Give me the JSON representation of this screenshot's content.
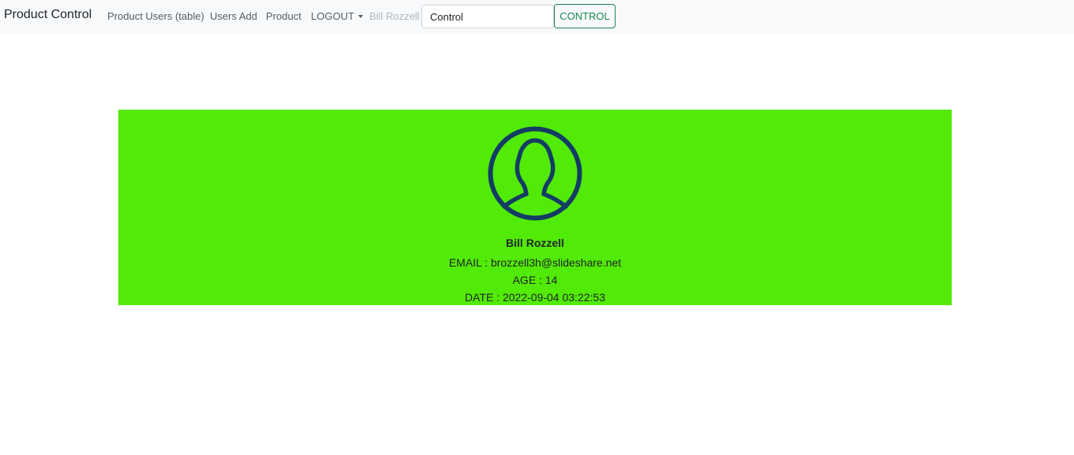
{
  "navbar": {
    "brand": "Product Control",
    "links": [
      {
        "label": "Product Users (table)"
      },
      {
        "label": "Users Add"
      },
      {
        "label": "Product"
      },
      {
        "label": "LOGOUT"
      }
    ],
    "current_user": "Bill Rozzell",
    "search": {
      "value": "Control",
      "placeholder": ""
    },
    "control_button": "CONTROL"
  },
  "profile": {
    "avatar_icon": "user-circle-icon",
    "name": "Bill Rozzell",
    "email_label": "EMAIL : brozzell3h@slideshare.net",
    "age_label": "AGE : 14",
    "date_label": "DATE : 2022-09-04 03:22:53"
  },
  "colors": {
    "navbar_bg": "#f8f9fa",
    "card_bg": "#52ea07",
    "avatar_stroke": "#143d63",
    "button_accent": "#198754"
  }
}
